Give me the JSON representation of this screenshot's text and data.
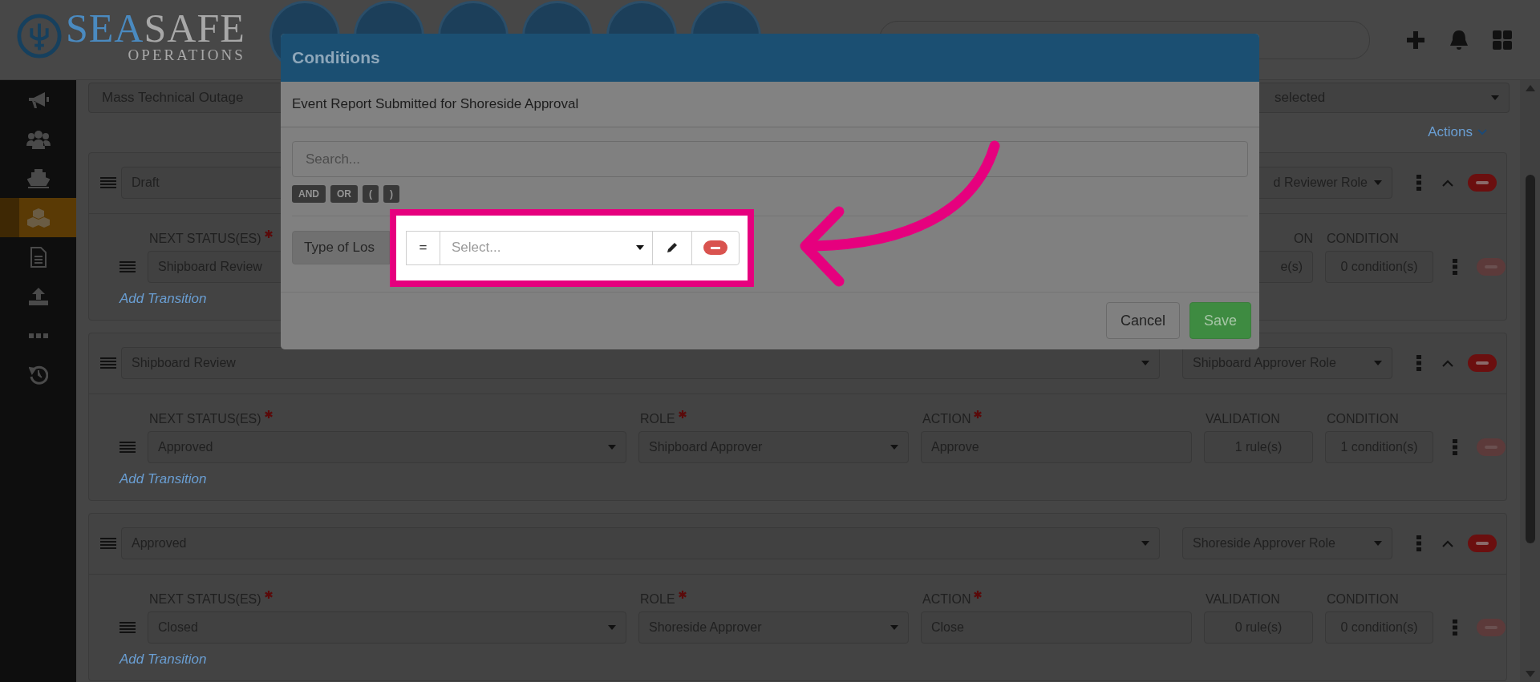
{
  "logo": {
    "primary": "SEA",
    "secondary": "SAFE",
    "tagline": "OPERATIONS"
  },
  "sidebar": {
    "items": [
      {
        "kind": "megaphone",
        "selected": false
      },
      {
        "kind": "users",
        "selected": false
      },
      {
        "kind": "ship",
        "selected": false
      },
      {
        "kind": "cubes",
        "selected": true
      },
      {
        "kind": "file",
        "selected": false
      },
      {
        "kind": "upload",
        "selected": false
      },
      {
        "kind": "dots",
        "selected": false
      },
      {
        "kind": "history",
        "selected": false
      }
    ]
  },
  "filters": {
    "name": "Mass Technical Outage",
    "dropdown": "selected"
  },
  "actions_link": "Actions",
  "statuses": [
    {
      "status": "Draft",
      "role": "d Reviewer Role",
      "role_cut": true,
      "expanded": true,
      "add_label": "Add Transition",
      "headers": {
        "next": {
          "label": "NEXT STATUS(ES)",
          "required": true,
          "cut": false
        },
        "validation": {
          "label": "ON",
          "required": false,
          "cut": true
        },
        "condition": {
          "label": "CONDITION",
          "required": false,
          "cut": false
        }
      },
      "transitions": [
        {
          "disabled": true,
          "cells": {
            "next": {
              "kind": "select",
              "value": "Shipboard Review",
              "cut": false
            },
            "validation": {
              "kind": "count",
              "value": "e(s)",
              "cut": true
            },
            "condition": {
              "kind": "count",
              "value": "0 condition(s)",
              "cut": false
            }
          }
        }
      ]
    },
    {
      "status": "Shipboard Review",
      "role": "Shipboard Approver Role",
      "role_cut": false,
      "expanded": true,
      "add_label": "Add Transition",
      "headers": {
        "next": {
          "label": "NEXT STATUS(ES)",
          "required": true,
          "cut": false
        },
        "role": {
          "label": "ROLE",
          "required": true,
          "cut": false
        },
        "action": {
          "label": "ACTION",
          "required": true,
          "cut": false
        },
        "validation": {
          "label": "VALIDATION",
          "required": false,
          "cut": false
        },
        "condition": {
          "label": "CONDITION",
          "required": false,
          "cut": false
        }
      },
      "transitions": [
        {
          "disabled": true,
          "cells": {
            "next": {
              "kind": "select",
              "value": "Approved",
              "cut": false
            },
            "role": {
              "kind": "select",
              "value": "Shipboard Approver",
              "cut": false
            },
            "action": {
              "kind": "text",
              "value": "Approve",
              "cut": false
            },
            "validation": {
              "kind": "count",
              "value": "1 rule(s)",
              "cut": false
            },
            "condition": {
              "kind": "count",
              "value": "1 condition(s)",
              "cut": false
            }
          }
        }
      ]
    },
    {
      "status": "Approved",
      "role": "Shoreside Approver Role",
      "role_cut": false,
      "expanded": true,
      "add_label": "Add Transition",
      "headers": {
        "next": {
          "label": "NEXT STATUS(ES)",
          "required": true,
          "cut": false
        },
        "role": {
          "label": "ROLE",
          "required": true,
          "cut": false
        },
        "action": {
          "label": "ACTION",
          "required": true,
          "cut": false
        },
        "validation": {
          "label": "VALIDATION",
          "required": false,
          "cut": false
        },
        "condition": {
          "label": "CONDITION",
          "required": false,
          "cut": false
        }
      },
      "transitions": [
        {
          "disabled": true,
          "cells": {
            "next": {
              "kind": "select",
              "value": "Closed",
              "cut": false
            },
            "role": {
              "kind": "select",
              "value": "Shoreside Approver",
              "cut": false
            },
            "action": {
              "kind": "text",
              "value": "Close",
              "cut": false
            },
            "validation": {
              "kind": "count",
              "value": "0 rule(s)",
              "cut": false
            },
            "condition": {
              "kind": "count",
              "value": "0 condition(s)",
              "cut": false
            }
          }
        }
      ]
    }
  ],
  "modal": {
    "title": "Conditions",
    "subtitle": "Event Report Submitted for Shoreside Approval",
    "search": {
      "placeholder": "Search..."
    },
    "operators": [
      "AND",
      "OR",
      "(",
      ")"
    ],
    "condition": {
      "field": "Type of Los",
      "operator": "=",
      "value": {
        "placeholder": "Select..."
      }
    },
    "buttons": [
      {
        "kind": "cancel",
        "label": "Cancel"
      },
      {
        "kind": "save",
        "label": "Save"
      }
    ]
  }
}
